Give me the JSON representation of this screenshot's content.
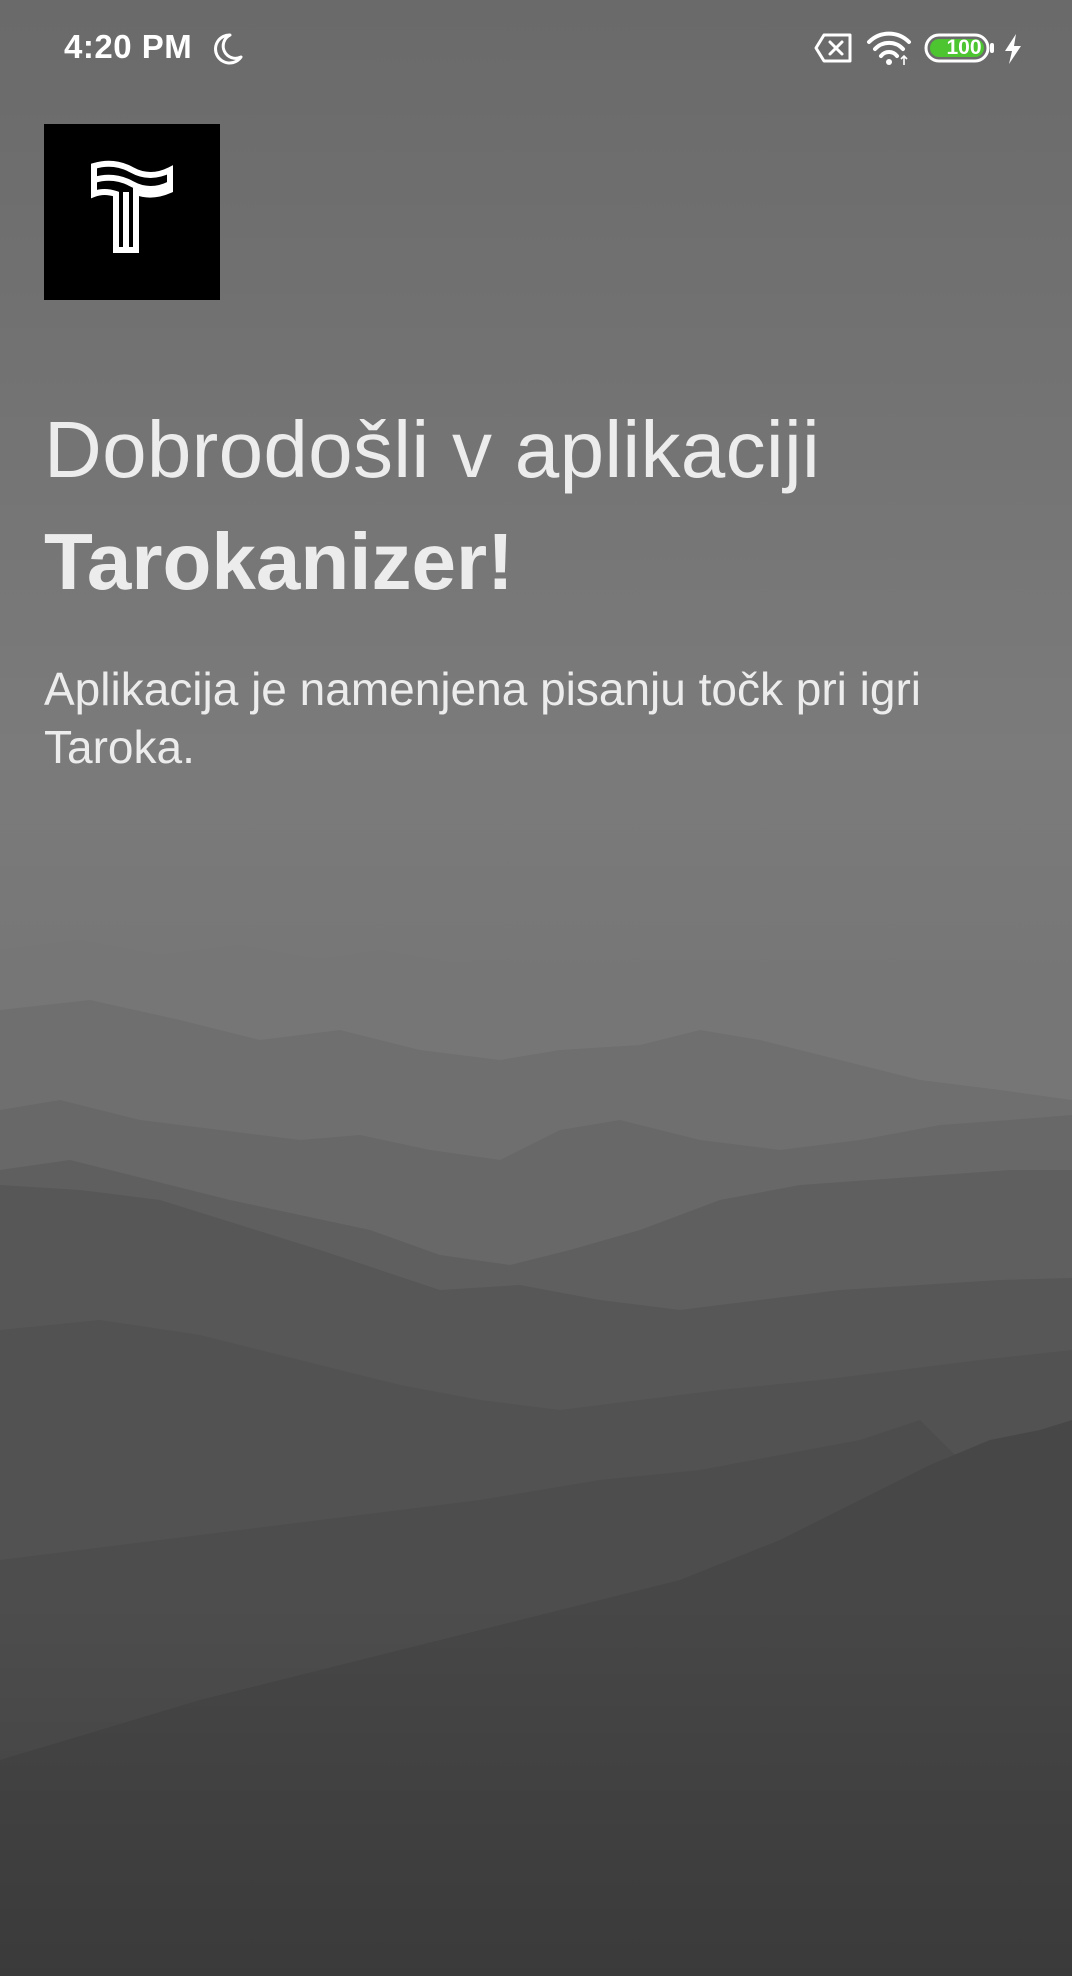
{
  "status_bar": {
    "time": "4:20 PM",
    "battery_level": "100",
    "icons": [
      "moon-icon",
      "no-sim-icon",
      "wifi-icon",
      "battery-icon",
      "charging-bolt-icon"
    ],
    "battery_color": "#4cc531"
  },
  "app": {
    "logo_icon": "tarokanizer-logo-icon",
    "welcome_line": "Dobrodošli v aplikaciji",
    "app_name": "Tarokanizer!",
    "description": "Aplikacija je namenjena pisanju točk pri igri Taroka."
  },
  "colors": {
    "text": "#ececec",
    "logo_background": "#000000"
  }
}
